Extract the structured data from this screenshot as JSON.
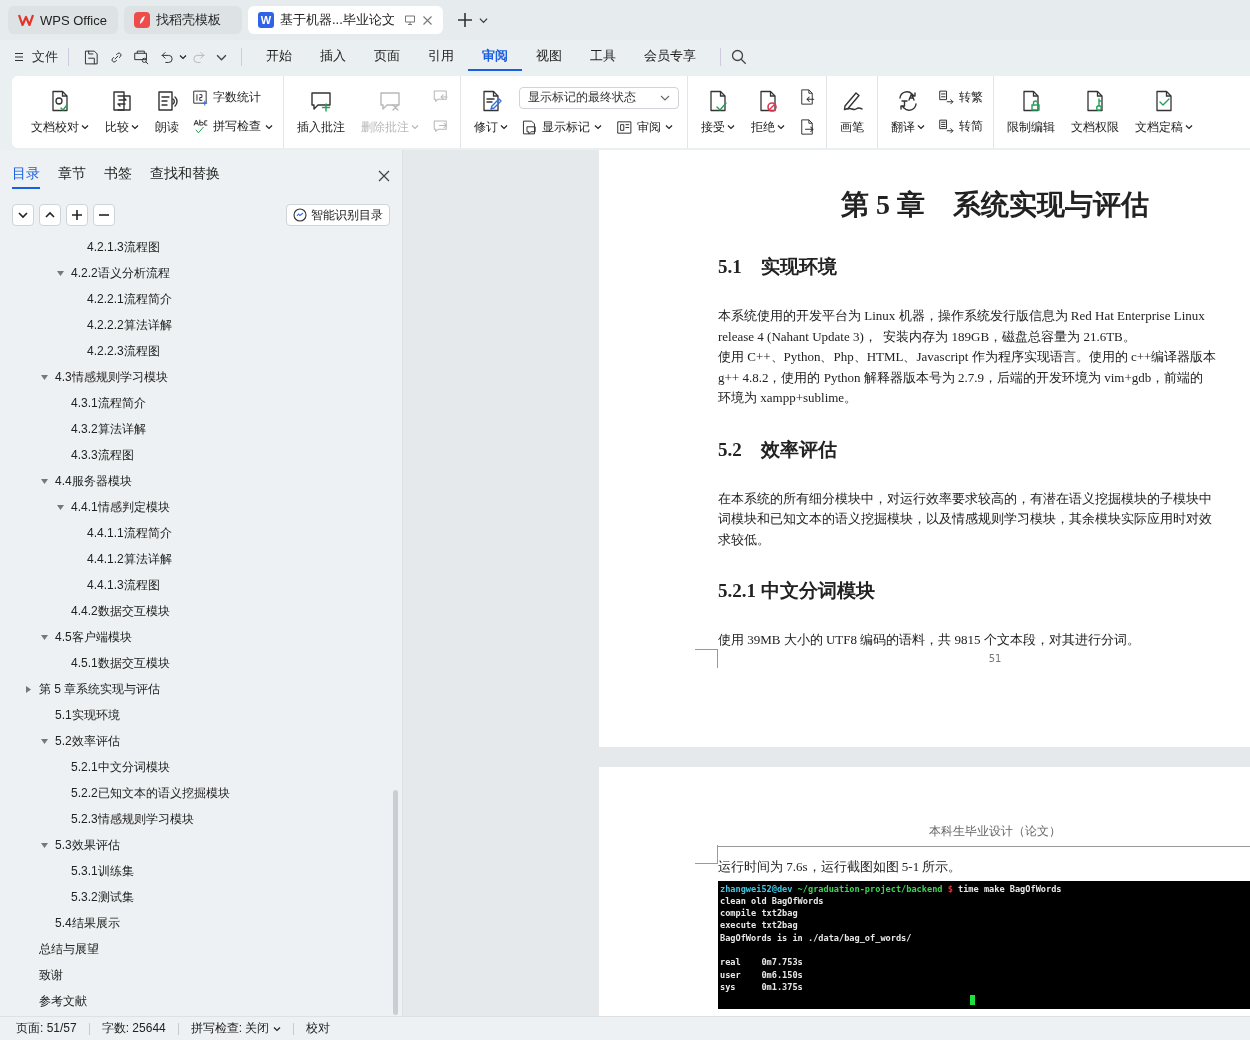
{
  "tabs": [
    {
      "label": "WPS Office",
      "selected": false,
      "kind": "home"
    },
    {
      "label": "找稻壳模板",
      "selected": false,
      "kind": "templates"
    },
    {
      "label": "基于机器...毕业论文",
      "selected": true,
      "kind": "document",
      "badge": "W"
    }
  ],
  "menu": {
    "file": "文件",
    "quick_actions": [
      {
        "disabled": false
      },
      {
        "disabled": false
      },
      {
        "disabled": false
      },
      {
        "disabled": false
      },
      {
        "disabled": true
      }
    ],
    "tabs": [
      {
        "label": "开始",
        "selected": false
      },
      {
        "label": "插入",
        "selected": false
      },
      {
        "label": "页面",
        "selected": false
      },
      {
        "label": "引用",
        "selected": false
      },
      {
        "label": "审阅",
        "selected": true
      },
      {
        "label": "视图",
        "selected": false
      },
      {
        "label": "工具",
        "selected": false
      },
      {
        "label": "会员专享",
        "selected": false
      }
    ]
  },
  "ribbon": [
    {
      "items": [
        {
          "kind": "large",
          "label": "文档校对",
          "dropdown": true,
          "disabled": false
        },
        {
          "kind": "large",
          "label": "比较",
          "dropdown": true,
          "disabled": false
        },
        {
          "kind": "large",
          "label": "朗读",
          "dropdown": false,
          "disabled": false
        },
        {
          "kind": "stack",
          "items": [
            {
              "kind": "small",
              "label": "字数统计",
              "dropdown": false,
              "disabled": false
            },
            {
              "kind": "small",
              "label": "拼写检查",
              "dropdown": true,
              "disabled": false
            }
          ]
        }
      ]
    },
    {
      "items": [
        {
          "kind": "large",
          "label": "插入批注",
          "dropdown": false,
          "disabled": false
        },
        {
          "kind": "large",
          "label": "删除批注",
          "dropdown": true,
          "disabled": true
        },
        {
          "kind": "stack",
          "items": [
            {
              "kind": "icon",
              "disabled": true
            },
            {
              "kind": "icon",
              "disabled": true
            }
          ]
        }
      ]
    },
    {
      "items": [
        {
          "kind": "large",
          "label": "修订",
          "dropdown": true,
          "disabled": false
        },
        {
          "kind": "stack",
          "items": [
            {
              "kind": "select",
              "value": "显示标记的最终状态"
            },
            {
              "kind": "row",
              "items": [
                {
                  "kind": "small",
                  "label": "显示标记",
                  "dropdown": true,
                  "disabled": false
                },
                {
                  "kind": "small",
                  "label": "审阅",
                  "dropdown": true,
                  "disabled": false
                }
              ]
            }
          ]
        }
      ]
    },
    {
      "items": [
        {
          "kind": "large",
          "label": "接受",
          "dropdown": true,
          "disabled": false
        },
        {
          "kind": "large",
          "label": "拒绝",
          "dropdown": true,
          "disabled": false
        },
        {
          "kind": "stack",
          "items": [
            {
              "kind": "icon",
              "disabled": false
            },
            {
              "kind": "icon",
              "disabled": false
            }
          ]
        }
      ]
    },
    {
      "items": [
        {
          "kind": "large",
          "label": "画笔",
          "dropdown": false,
          "disabled": false
        }
      ]
    },
    {
      "items": [
        {
          "kind": "large",
          "label": "翻译",
          "dropdown": true,
          "disabled": false
        },
        {
          "kind": "stack",
          "items": [
            {
              "kind": "small",
              "label": "转繁",
              "dropdown": false,
              "disabled": false
            },
            {
              "kind": "small",
              "label": "转简",
              "dropdown": false,
              "disabled": false
            }
          ]
        }
      ]
    },
    {
      "items": [
        {
          "kind": "large",
          "label": "限制编辑",
          "dropdown": false,
          "disabled": false
        },
        {
          "kind": "large",
          "label": "文档权限",
          "dropdown": false,
          "disabled": false
        },
        {
          "kind": "large",
          "label": "文档定稿",
          "dropdown": true,
          "disabled": false
        }
      ]
    }
  ],
  "sidebar": {
    "tabs": [
      {
        "label": "目录",
        "selected": true
      },
      {
        "label": "章节",
        "selected": false
      },
      {
        "label": "书签",
        "selected": false
      },
      {
        "label": "查找和替换",
        "selected": false
      }
    ],
    "smart_button": "智能识别目录",
    "outline": [
      {
        "children": [
          {
            "children": [
              {
                "children": [
                  {
                    "label": "4.2.1.3流程图"
                  }
                ]
              },
              {
                "label": "4.2.2语义分析流程",
                "expanded": true,
                "children": [
                  {
                    "label": "4.2.2.1流程简介"
                  },
                  {
                    "label": "4.2.2.2算法详解"
                  },
                  {
                    "label": "4.2.2.3流程图"
                  }
                ]
              }
            ]
          },
          {
            "label": "4.3情感规则学习模块",
            "expanded": true,
            "children": [
              {
                "label": "4.3.1流程简介"
              },
              {
                "label": "4.3.2算法详解"
              },
              {
                "label": "4.3.3流程图"
              }
            ]
          },
          {
            "label": "4.4服务器模块",
            "expanded": true,
            "children": [
              {
                "label": "4.4.1情感判定模块",
                "expanded": true,
                "children": [
                  {
                    "label": "4.4.1.1流程简介"
                  },
                  {
                    "label": "4.4.1.2算法详解"
                  },
                  {
                    "label": "4.4.1.3流程图"
                  }
                ]
              },
              {
                "label": "4.4.2数据交互模块"
              }
            ]
          },
          {
            "label": "4.5客户端模块",
            "expanded": true,
            "children": [
              {
                "label": "4.5.1数据交互模块"
              }
            ]
          }
        ]
      },
      {
        "label": "第 5 章系统实现与评估",
        "expanded": false,
        "children": [
          {
            "label": "5.1实现环境"
          },
          {
            "label": "5.2效率评估",
            "expanded": true,
            "children": [
              {
                "label": "5.2.1中文分词模块"
              },
              {
                "label": "5.2.2已知文本的语义挖掘模块"
              },
              {
                "label": "5.2.3情感规则学习模块"
              }
            ]
          },
          {
            "label": "5.3效果评估",
            "expanded": true,
            "children": [
              {
                "label": "5.3.1训练集"
              },
              {
                "label": "5.3.2测试集"
              }
            ]
          },
          {
            "label": "5.4结果展示"
          }
        ]
      },
      {
        "label": "总结与展望"
      },
      {
        "label": "致谢"
      },
      {
        "label": "参考文献"
      }
    ]
  },
  "pages": [
    {
      "blocks": [
        {
          "kind": "chapter",
          "text": "第 5 章　系统实现与评估"
        },
        {
          "kind": "heading",
          "text": "5.1　实现环境"
        },
        {
          "kind": "paragraph",
          "lines": [
            "本系统使用的开发平台为 Linux 机器，操作系统发行版信息为 Red Hat Enterprise Linux",
            "release 4 (Nahant Update 3)，  安装内存为 189GB，磁盘总容量为 21.6TB。",
            "使用 C++、Python、Php、HTML、Javascript 作为程序实现语言。使用的 c++编译器版本",
            "g++ 4.8.2，使用的 Python 解释器版本号为 2.7.9，后端的开发环境为 vim+gdb，前端的",
            "环境为 xampp+sublime。"
          ]
        },
        {
          "kind": "heading",
          "text": "5.2　效率评估"
        },
        {
          "kind": "paragraph",
          "lines": [
            "在本系统的所有细分模块中，对运行效率要求较高的，有潜在语义挖掘模块的子模块中",
            "词模块和已知文本的语义挖掘模块，以及情感规则学习模块，其余模块实际应用时对效",
            "求较低。"
          ]
        },
        {
          "kind": "subheading",
          "text": "5.2.1 中文分词模块"
        },
        {
          "kind": "paragraph",
          "lines": [
            "使用 39MB 大小的 UTF8 编码的语料，共 9815 个文本段，对其进行分词。"
          ]
        }
      ],
      "page_number": "51"
    },
    {
      "header": "本科生毕业设计（论文）",
      "blocks": [
        {
          "kind": "paragraph",
          "lines": [
            "运行时间为 7.6s，运行截图如图 5-1 所示。"
          ]
        },
        {
          "kind": "terminal",
          "groups": [
            [
              {
                "segments": [
                  {
                    "text": "zhangwei52@dev",
                    "color": "#3cc8e6"
                  },
                  {
                    "text": " ~/graduation-project/backend",
                    "color": "#3fd455"
                  },
                  {
                    "text": " $",
                    "color": "#e8322e"
                  },
                  {
                    "text": " time make BagOfWords",
                    "color": "#e8e8e8"
                  }
                ]
              },
              {
                "segments": [
                  {
                    "text": "clean old BagOfWords",
                    "color": "#e8e8e8"
                  }
                ]
              },
              {
                "segments": [
                  {
                    "text": "compile txt2bag",
                    "color": "#e8e8e8"
                  }
                ]
              },
              {
                "segments": [
                  {
                    "text": "execute txt2bag",
                    "color": "#e8e8e8"
                  }
                ]
              },
              {
                "segments": [
                  {
                    "text": "BagOfWords is in ./data/bag_of_words/",
                    "color": "#e8e8e8"
                  }
                ]
              }
            ],
            [
              {
                "segments": [
                  {
                    "text": "real    0m7.753s",
                    "color": "#e8e8e8"
                  }
                ]
              },
              {
                "segments": [
                  {
                    "text": "user    0m6.150s",
                    "color": "#e8e8e8"
                  }
                ]
              },
              {
                "segments": [
                  {
                    "text": "sys     0m1.375s",
                    "color": "#e8e8e8"
                  }
                ]
              }
            ]
          ]
        }
      ]
    }
  ],
  "status_bar": {
    "page": "页面: 51/57",
    "words": "字数: 25644",
    "spell": "拼写检查: 关闭",
    "proof": "校对"
  }
}
